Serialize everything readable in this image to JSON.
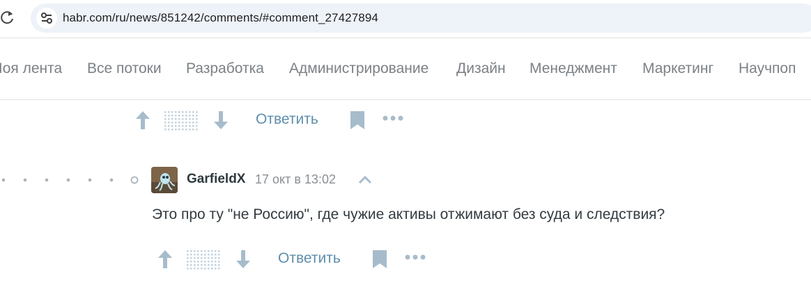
{
  "browser": {
    "url": "habr.com/ru/news/851242/comments/#comment_27427894",
    "reload_icon": "reload-icon",
    "site_info_icon": "tune-icon"
  },
  "nav": {
    "items": [
      {
        "label": "Моя лента"
      },
      {
        "label": "Все потоки"
      },
      {
        "label": "Разработка"
      },
      {
        "label": "Администрирование"
      },
      {
        "label": "Дизайн"
      },
      {
        "label": "Менеджмент"
      },
      {
        "label": "Маркетинг"
      },
      {
        "label": "Научпоп"
      }
    ]
  },
  "actions_top": {
    "reply_label": "Ответить"
  },
  "comment": {
    "author": "GarfieldX",
    "date": "17 окт в 13:02",
    "text": "Это про ту \"не Россию\", где чужие активы отжимают без суда и следствия?",
    "reply_label": "Ответить"
  },
  "colors": {
    "icon": "#a7bccb",
    "link": "#5e8eac",
    "nav_text": "#7b8186"
  }
}
